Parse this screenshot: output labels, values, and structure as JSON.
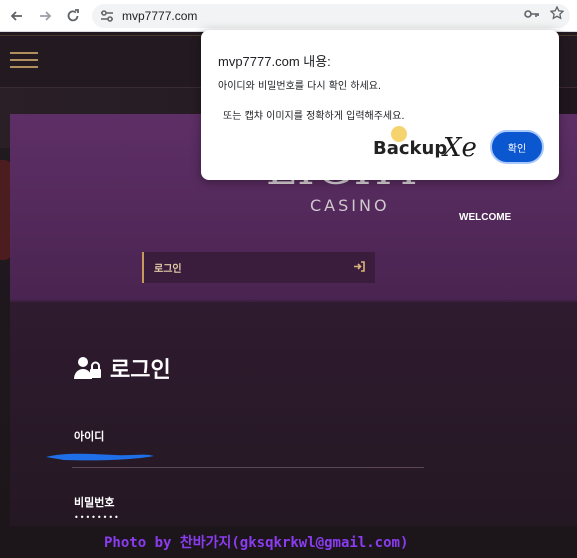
{
  "browser": {
    "url": "mvp7777.com",
    "back_icon": "arrow-left-icon",
    "forward_icon": "arrow-right-icon",
    "reload_icon": "reload-icon",
    "site_info_icon": "tune-icon",
    "key_icon": "key-icon",
    "star_icon": "star-icon"
  },
  "alert": {
    "title": "mvp7777.com 내용:",
    "message_line1": "아이디와 비밀번호를 다시 확인 하세요.",
    "message_line2": "또는 캡챠 이미지를 정확하게 입력해주세요.",
    "ok_label": "확인",
    "overlay_logo": "BackupXe"
  },
  "site": {
    "logo_main": "LIGHT",
    "logo_sub": "CASINO",
    "welcome": "WELCOME",
    "login_bar_label": "로그인",
    "login_heading": "로그인",
    "id_label": "아이디",
    "password_label": "비밀번호",
    "password_value": "••••••••"
  },
  "watermark": "Photo by 찬바가지(gksqkrkwl@gmail.com)",
  "colors": {
    "accent_gold": "#c79a5a",
    "panel_purple": "#5b2d62",
    "dialog_button": "#0b57d0",
    "watermark": "#8a3cf0"
  }
}
